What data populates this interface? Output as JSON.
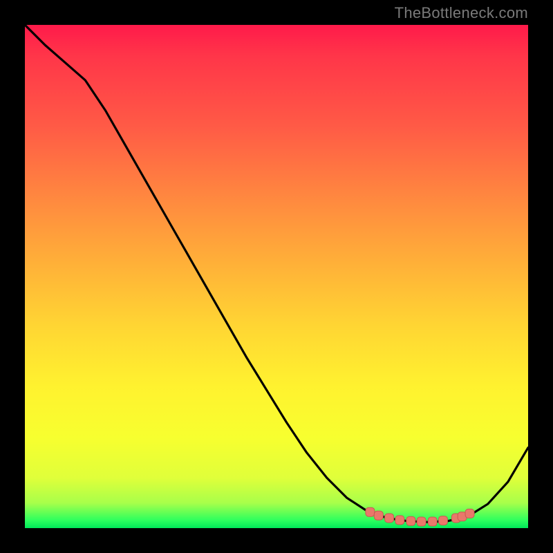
{
  "watermark": "TheBottleneck.com",
  "colors": {
    "frame": "#000000",
    "curve": "#000000",
    "marker_fill": "#e9786a",
    "marker_stroke": "#c75a50",
    "gradient_top": "#ff1a4a",
    "gradient_bottom": "#00e85a"
  },
  "chart_data": {
    "type": "line",
    "title": "",
    "xlabel": "",
    "ylabel": "",
    "xlim": [
      0,
      100
    ],
    "ylim": [
      0,
      100
    ],
    "grid": false,
    "legend": false,
    "series": [
      {
        "name": "bottleneck-curve",
        "x": [
          0,
          4,
          8,
          12,
          16,
          20,
          24,
          28,
          32,
          36,
          40,
          44,
          48,
          52,
          56,
          60,
          64,
          68,
          72,
          76,
          80,
          84,
          88,
          92,
          96,
          100
        ],
        "y": [
          100,
          96,
          92.5,
          89,
          83,
          76,
          69,
          62,
          55,
          48,
          41,
          34,
          27.5,
          21,
          15,
          10,
          6,
          3.4,
          2.0,
          1.4,
          1.2,
          1.4,
          2.3,
          4.8,
          9.2,
          16
        ]
      }
    ],
    "markers": {
      "name": "optimum-band",
      "x": [
        68.6,
        70.3,
        72.4,
        74.5,
        76.7,
        78.8,
        81.0,
        83.1,
        85.7,
        86.9,
        88.4
      ],
      "y": [
        3.2,
        2.5,
        2.0,
        1.6,
        1.4,
        1.3,
        1.3,
        1.5,
        2.0,
        2.3,
        2.9
      ]
    }
  }
}
